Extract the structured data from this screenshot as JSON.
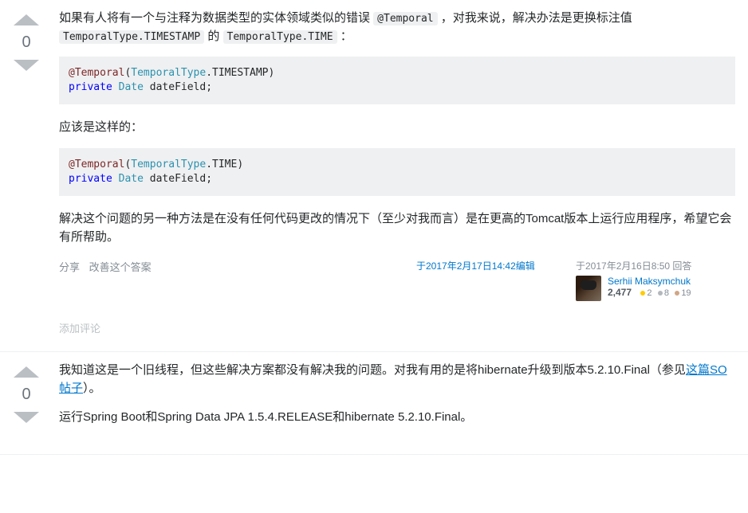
{
  "answers": [
    {
      "votes": 0,
      "body": {
        "p1_pre": "如果有人将有一个与注释为数据类型的实体领域类似的错误 ",
        "p1_code": "@Temporal",
        "p1_post": " ，对我来说，解决办法是更换标注值 ",
        "p1_code2": "TemporalType.TIMESTAMP",
        "p1_mid": " 的 ",
        "p1_code3": "TemporalType.TIME",
        "p1_end": " ：",
        "code1": {
          "meta": "@Temporal",
          "open": "(",
          "type": "TemporalType",
          "dot": ".TIMESTAMP)",
          "kw": "private",
          "sp": " ",
          "type2": "Date",
          "field": " dateField;"
        },
        "p2": "应该是这样的：",
        "code2": {
          "meta": "@Temporal",
          "open": "(",
          "type": "TemporalType",
          "dot": ".TIME)",
          "kw": "private",
          "sp": " ",
          "type2": "Date",
          "field": " dateField;"
        },
        "p3": "解决这个问题的另一种方法是在没有任何代码更改的情况下（至少对我而言）是在更高的Tomcat版本上运行应用程序，希望它会有所帮助。"
      },
      "actions": {
        "share": "分享",
        "improve": "改善这个答案"
      },
      "edit": "于2017年2月17日14:42编辑",
      "user": {
        "time": "于2017年2月16日8:50 回答",
        "name": "Serhii Maksymchuk",
        "rep": "2,477",
        "gold": "2",
        "silver": "8",
        "bronze": "19"
      },
      "add_comment": "添加评论"
    },
    {
      "votes": 0,
      "body": {
        "p1a": "我知道这是一个旧线程，但这些解决方案都没有解决我的问题。对我有用的是将hibernate升级到版本5.2.10.Final（参见",
        "p1_link": "这篇SO帖子",
        "p1b": "）。",
        "p2": "运行Spring Boot和Spring Data JPA 1.5.4.RELEASE和hibernate 5.2.10.Final。"
      }
    }
  ]
}
